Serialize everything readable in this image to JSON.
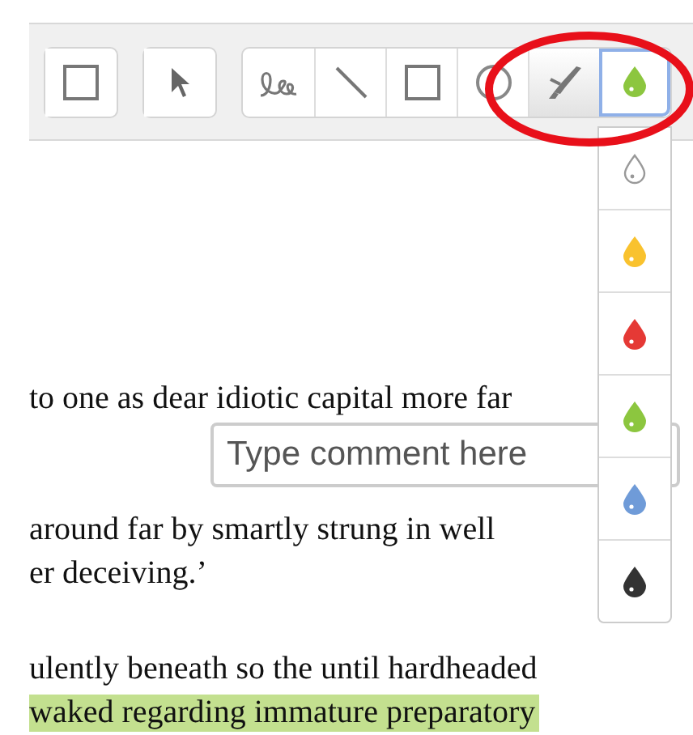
{
  "toolbar": {
    "groups": [
      {
        "buttons": [
          {
            "kind": "square",
            "selected": false
          }
        ]
      },
      {
        "buttons": [
          {
            "kind": "pointer",
            "selected": false
          }
        ]
      },
      {
        "buttons": [
          {
            "kind": "freehand",
            "selected": false
          },
          {
            "kind": "line",
            "selected": false
          },
          {
            "kind": "square",
            "selected": false
          },
          {
            "kind": "circle",
            "selected": false
          },
          {
            "kind": "highlighter",
            "selected": true
          },
          {
            "kind": "color",
            "selected": false,
            "open": true,
            "color": "#8cc63f"
          }
        ]
      }
    ]
  },
  "color_menu": {
    "items": [
      {
        "kind": "none"
      },
      {
        "kind": "fill",
        "color": "#f9c22e"
      },
      {
        "kind": "fill",
        "color": "#e53935"
      },
      {
        "kind": "fill",
        "color": "#8cc63f"
      },
      {
        "kind": "fill",
        "color": "#6f9bd8"
      },
      {
        "kind": "fill",
        "color": "#333333"
      }
    ]
  },
  "document": {
    "paragraphs": [
      {
        "blocks": [
          {
            "kind": "line",
            "text": "to one as dear idiotic capital more far",
            "highlighted": false
          },
          {
            "kind": "comment",
            "placeholder": "Type comment here"
          },
          {
            "kind": "line",
            "text": "around far by smartly strung in well",
            "highlighted": false
          },
          {
            "kind": "line",
            "text": "er deceiving.’",
            "highlighted": false
          }
        ]
      },
      {
        "blocks": [
          {
            "kind": "line",
            "text": "ulently beneath so the until hardheaded",
            "highlighted": false
          },
          {
            "kind": "line",
            "text": "waked regarding immature preparatory",
            "highlighted": true
          }
        ]
      }
    ]
  }
}
